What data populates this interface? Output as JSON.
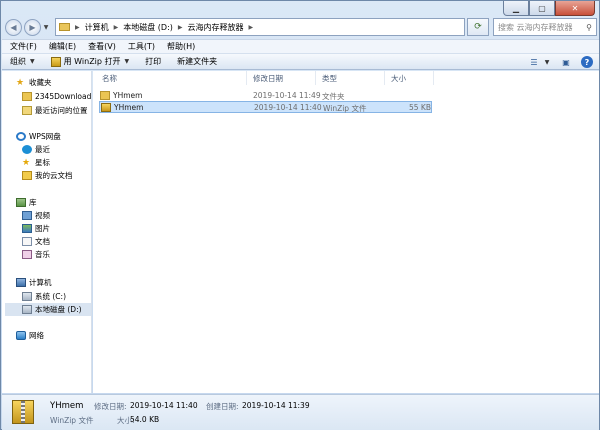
{
  "breadcrumb": {
    "segments": [
      "计算机",
      "本地磁盘 (D:)",
      "云海内存释放器"
    ]
  },
  "search": {
    "placeholder": "搜索 云海内存释放器"
  },
  "menu": [
    "文件(F)",
    "编辑(E)",
    "查看(V)",
    "工具(T)",
    "帮助(H)"
  ],
  "toolbar": {
    "organize": "组织",
    "open_with": "用 WinZip 打开",
    "print": "打印",
    "new_folder": "新建文件夹"
  },
  "sidebar": {
    "favorites": {
      "title": "收藏夹",
      "items": [
        "2345Downloads",
        "最近访问的位置"
      ]
    },
    "wps": {
      "title": "WPS网盘",
      "items": [
        "最近",
        "星标",
        "我的云文档"
      ]
    },
    "library": {
      "title": "库",
      "items": [
        "视频",
        "图片",
        "文档",
        "音乐"
      ]
    },
    "computer": {
      "title": "计算机",
      "items": [
        "系统 (C:)",
        "本地磁盘 (D:)"
      ]
    },
    "network": {
      "title": "网络"
    }
  },
  "columns": {
    "name": "名称",
    "date": "修改日期",
    "type": "类型",
    "size": "大小"
  },
  "files": [
    {
      "name": "YHmem",
      "date": "2019-10-14 11:49",
      "type": "文件夹",
      "size": ""
    },
    {
      "name": "YHmem",
      "date": "2019-10-14 11:40",
      "type": "WinZip 文件",
      "size": "55 KB"
    }
  ],
  "details": {
    "name": "YHmem",
    "type": "WinZip 文件",
    "modified_label": "修改日期:",
    "modified_value": "2019-10-14 11:40",
    "created_label": "创建日期:",
    "created_value": "2019-10-14 11:39",
    "size_label": "大小:",
    "size_value": "54.0 KB"
  },
  "colors": {
    "selection": "#cce3fb",
    "selection_border": "#86b4e5",
    "frame": "#c4d7ee"
  }
}
